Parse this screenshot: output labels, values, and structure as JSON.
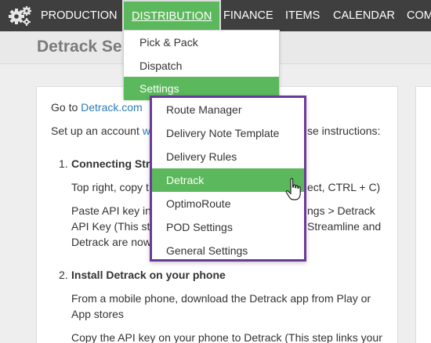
{
  "nav": {
    "items": [
      {
        "label": "PRODUCTION"
      },
      {
        "label": "DISTRIBUTION"
      },
      {
        "label": "FINANCE"
      },
      {
        "label": "ITEMS"
      },
      {
        "label": "CALENDAR"
      },
      {
        "label": "COM"
      }
    ],
    "gear_icon": "gears-icon"
  },
  "page": {
    "title": "Detrack Se"
  },
  "distribution_menu": {
    "items": [
      {
        "label": "Pick & Pack"
      },
      {
        "label": "Dispatch"
      },
      {
        "label": "Settings"
      }
    ]
  },
  "settings_menu": {
    "items": [
      {
        "label": "Route Manager"
      },
      {
        "label": "Delivery Note Template"
      },
      {
        "label": "Delivery Rules"
      },
      {
        "label": "Detrack"
      },
      {
        "label": "OptimoRoute"
      },
      {
        "label": "POD Settings"
      },
      {
        "label": "General Settings"
      }
    ]
  },
  "content": {
    "goto_prefix": "Go to ",
    "goto_link": "Detrack.com",
    "setup_prefix": "Set up an account ",
    "setup_link": "w",
    "setup_suffix": "se instructions:",
    "step1_num": "1.",
    "step1_title": "Connecting Str",
    "step1_l1a": "Top right, copy t",
    "step1_l1b": "ect, CTRL + C)",
    "step1_l2a": "Paste API key in",
    "step1_l2b": "ngs > Detrack",
    "step1_l3a": "API Key (This st",
    "step1_l3b": "Streamline and",
    "step1_l4": "Detrack are now",
    "step2_num": "2.",
    "step2_title": "Install Detrack on your phone",
    "step2_l1": "From a mobile phone, download the Detrack app from Play or",
    "step2_l2": "App stores",
    "step2_l3": "Copy the API key on your phone to Detrack (This step links your"
  },
  "colors": {
    "nav_bg": "#3f3f3f",
    "accent_green": "#5cb85c",
    "submenu_border": "#6a3a9a",
    "link": "#2a7ab8"
  }
}
